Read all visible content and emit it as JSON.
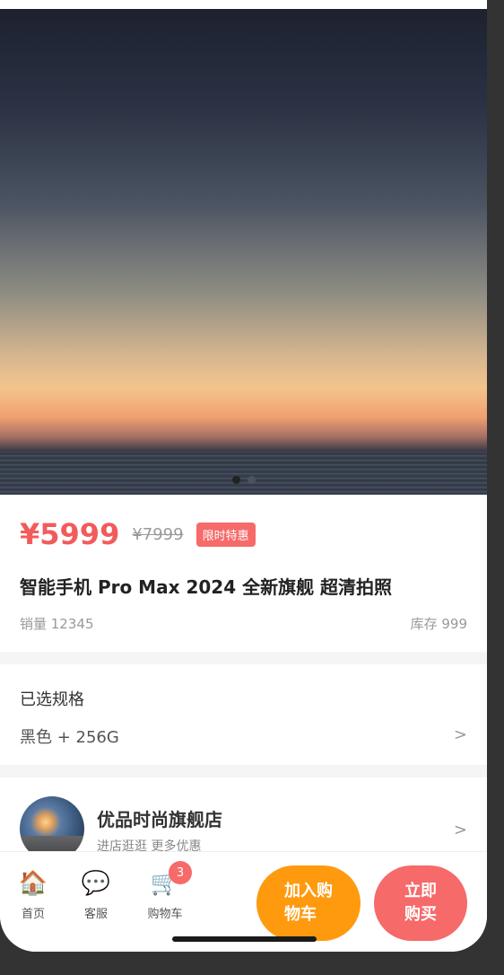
{
  "product": {
    "price": "¥5999",
    "original_price": "¥7999",
    "promo_tag": "限时特惠",
    "title": "智能手机 Pro Max 2024 全新旗舰 超清拍照",
    "sales": "销量 12345",
    "stock": "库存 999"
  },
  "gallery": {
    "total_images": 2,
    "active_index": 0
  },
  "spec": {
    "label": "已选规格",
    "value": "黑色 + 256G",
    "chevron": ">"
  },
  "store": {
    "name": "优品时尚旗舰店",
    "subtitle": "进店逛逛 更多优惠",
    "chevron": ">"
  },
  "bottom_bar": {
    "home": {
      "label": "首页",
      "icon": "house-icon"
    },
    "service": {
      "label": "客服",
      "icon": "chat-bubble-icon"
    },
    "cart": {
      "label": "购物车",
      "icon": "shopping-cart-icon",
      "badge": "3"
    },
    "add_to_cart_line1": "加入购",
    "add_to_cart_line2": "物车",
    "buy_now_line1": "立即",
    "buy_now_line2": "购买"
  },
  "colors": {
    "price": "#f25b5b",
    "add_to_cart": "#ff9a0f",
    "buy_now": "#f66a6a"
  }
}
